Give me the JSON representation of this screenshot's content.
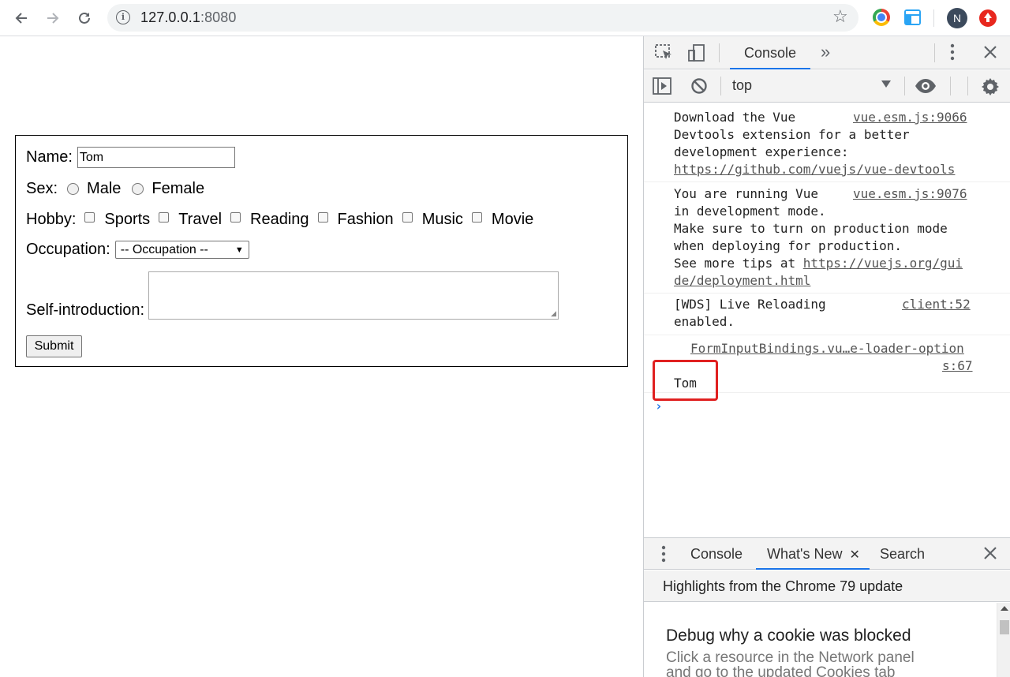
{
  "browser": {
    "url_host": "127.0.0.1",
    "url_port": ":8080",
    "avatar_letter": "N"
  },
  "form": {
    "name_label": "Name:",
    "name_value": "Tom",
    "sex_label": "Sex:",
    "sex_options": [
      "Male",
      "Female"
    ],
    "hobby_label": "Hobby:",
    "hobbies": [
      "Sports",
      "Travel",
      "Reading",
      "Fashion",
      "Music",
      "Movie"
    ],
    "occupation_label": "Occupation:",
    "occupation_selected": "-- Occupation --",
    "intro_label": "Self-introduction:",
    "submit_label": "Submit"
  },
  "devtools": {
    "main_tab": "Console",
    "more_tabs_glyph": "»",
    "context": "top",
    "messages": [
      {
        "lines": [
          "Download the Vue",
          "Devtools extension for a better",
          "development experience:"
        ],
        "link": "https://github.com/vuejs/vue-devtools",
        "source": "vue.esm.js:9066"
      },
      {
        "lines": [
          "You are running Vue",
          "in development mode.",
          "Make sure to turn on production mode",
          "when deploying for production.",
          "See more tips at "
        ],
        "link_part1": "https://vuejs.org/gui",
        "link_part2": "de/deployment.html",
        "source": "vue.esm.js:9076"
      },
      {
        "lines": [
          "[WDS] Live Reloading",
          "enabled."
        ],
        "source": "client:52"
      },
      {
        "source_part1": "FormInputBindings.vu…e-loader-option",
        "source_part2": "s:67",
        "value": "Tom"
      }
    ],
    "prompt": "›",
    "drawer_tabs": [
      "Console",
      "What's New",
      "Search"
    ],
    "drawer_heading": "Highlights from the Chrome 79 update",
    "whats_new_title": "Debug why a cookie was blocked",
    "whats_new_desc_line1": "Click a resource in the Network panel",
    "whats_new_desc_line2": "and go to the updated Cookies tab"
  }
}
